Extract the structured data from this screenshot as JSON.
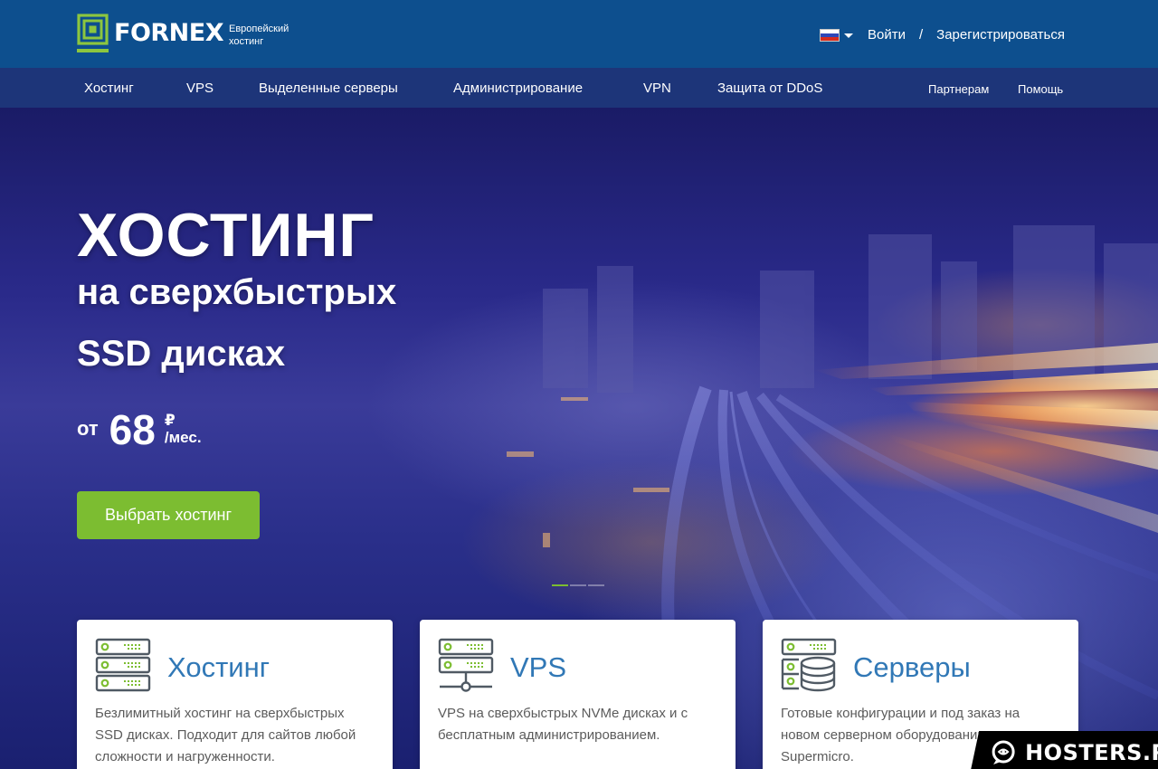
{
  "header": {
    "logo_text": "FORNEX",
    "tagline": "Европейский хостинг",
    "login": "Войти",
    "separator": "/",
    "register": "Зарегистрироваться"
  },
  "nav": {
    "items": [
      "Хостинг",
      "VPS",
      "Выделенные серверы",
      "Администрирование",
      "VPN",
      "Защита от DDoS"
    ],
    "right": [
      "Партнерам",
      "Помощь"
    ]
  },
  "hero": {
    "title": "ХОСТИНГ",
    "subtitle_line1": "на сверхбыстрых",
    "subtitle_line2": "SSD дисках",
    "price_prefix": "от",
    "price_value": "68",
    "currency": "₽",
    "per": "/мес.",
    "cta": "Выбрать хостинг"
  },
  "cards": [
    {
      "title": "Хостинг",
      "icon": "server-rack-icon",
      "desc": "Безлимитный хостинг на сверхбыстрых SSD дисках. Подходит для сайтов любой сложности и нагруженности."
    },
    {
      "title": "VPS",
      "icon": "network-server-icon",
      "desc": "VPS на сверхбыстрых NVMe дисках и с бесплатным администрированием."
    },
    {
      "title": "Серверы",
      "icon": "server-database-icon",
      "desc": "Готовые конфигурации и под заказ на новом серверном оборудовании Supermicro."
    }
  ],
  "watermark": "HOSTERS.RU",
  "colors": {
    "header": "#0d4f8e",
    "nav": "#1d3579",
    "accent": "#7cbd31",
    "card_title": "#3178b6"
  }
}
